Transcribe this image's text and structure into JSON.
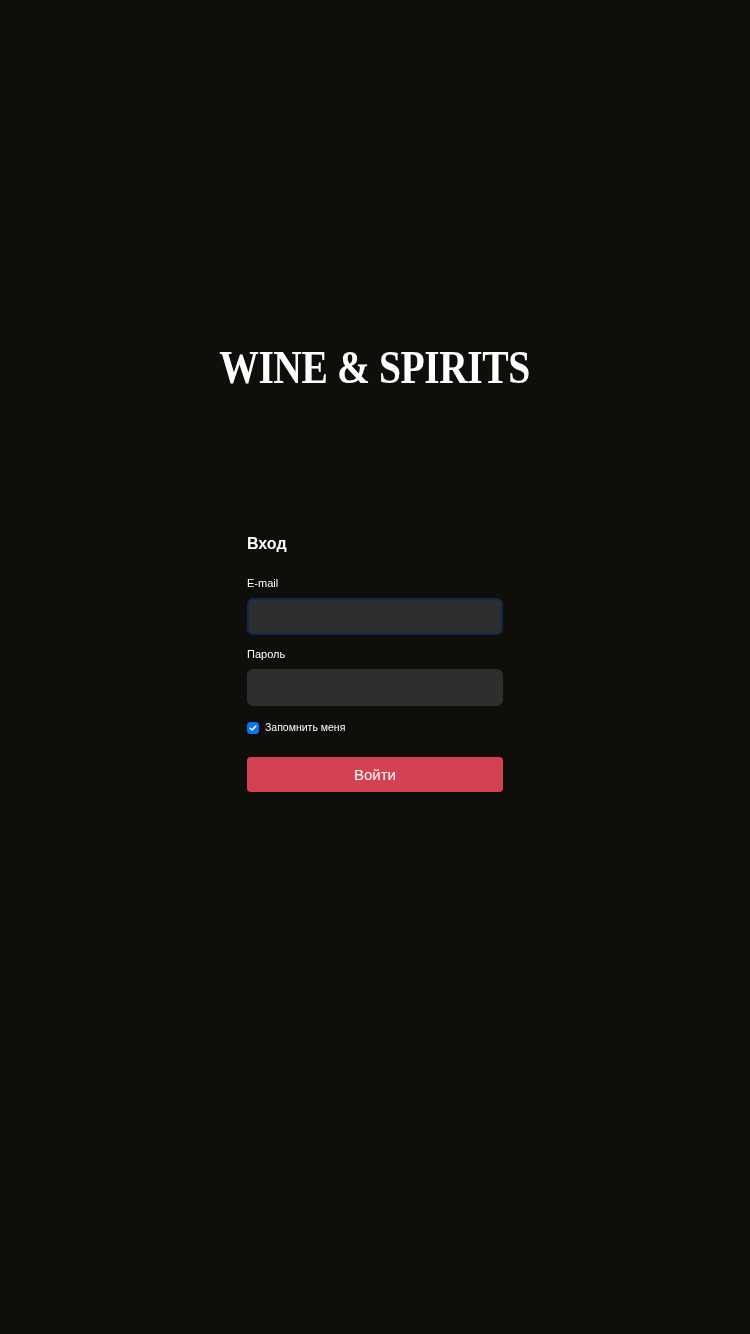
{
  "logo": {
    "text": "WINE & SPIRITS"
  },
  "login_form": {
    "title": "Вход",
    "fields": [
      {
        "label": "E-mail",
        "focused": true
      },
      {
        "label": "Пароль",
        "focused": false
      }
    ],
    "remember_me": {
      "label": "Запомнить меня",
      "checked": true
    },
    "submit_button": {
      "label": "Войти"
    }
  }
}
